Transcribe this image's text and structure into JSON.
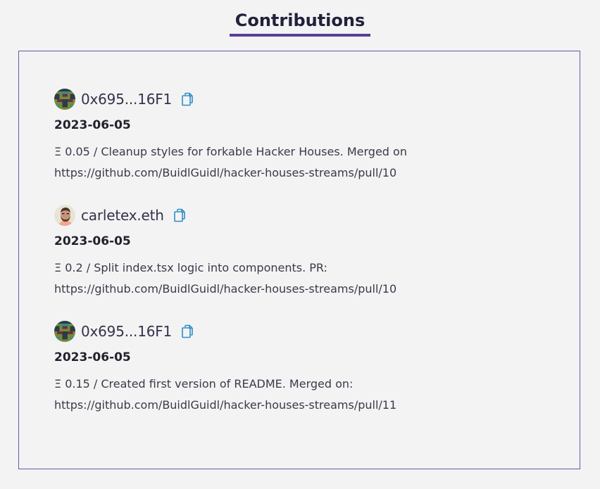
{
  "page": {
    "title": "Contributions"
  },
  "contributions": [
    {
      "user": "0x695...16F1",
      "avatar": "blocky-avatar",
      "date": "2023-06-05",
      "description": "Ξ 0.05 / Cleanup styles for forkable Hacker Houses. Merged on https://github.com/BuidlGuidl/hacker-houses-streams/pull/10"
    },
    {
      "user": "carletex.eth",
      "avatar": "person-avatar",
      "date": "2023-06-05",
      "description": "Ξ 0.2 / Split index.tsx logic into components. PR: https://github.com/BuidlGuidl/hacker-houses-streams/pull/10"
    },
    {
      "user": "0x695...16F1",
      "avatar": "blocky-avatar",
      "date": "2023-06-05",
      "description": "Ξ 0.15 / Created first version of README. Merged on: https://github.com/BuidlGuidl/hacker-houses-streams/pull/11"
    }
  ],
  "icons": {
    "copy": "copy-icon"
  },
  "colors": {
    "accent": "#5b3f97",
    "copy_icon": "#2f8fc4",
    "background": "#f3f3f4"
  }
}
